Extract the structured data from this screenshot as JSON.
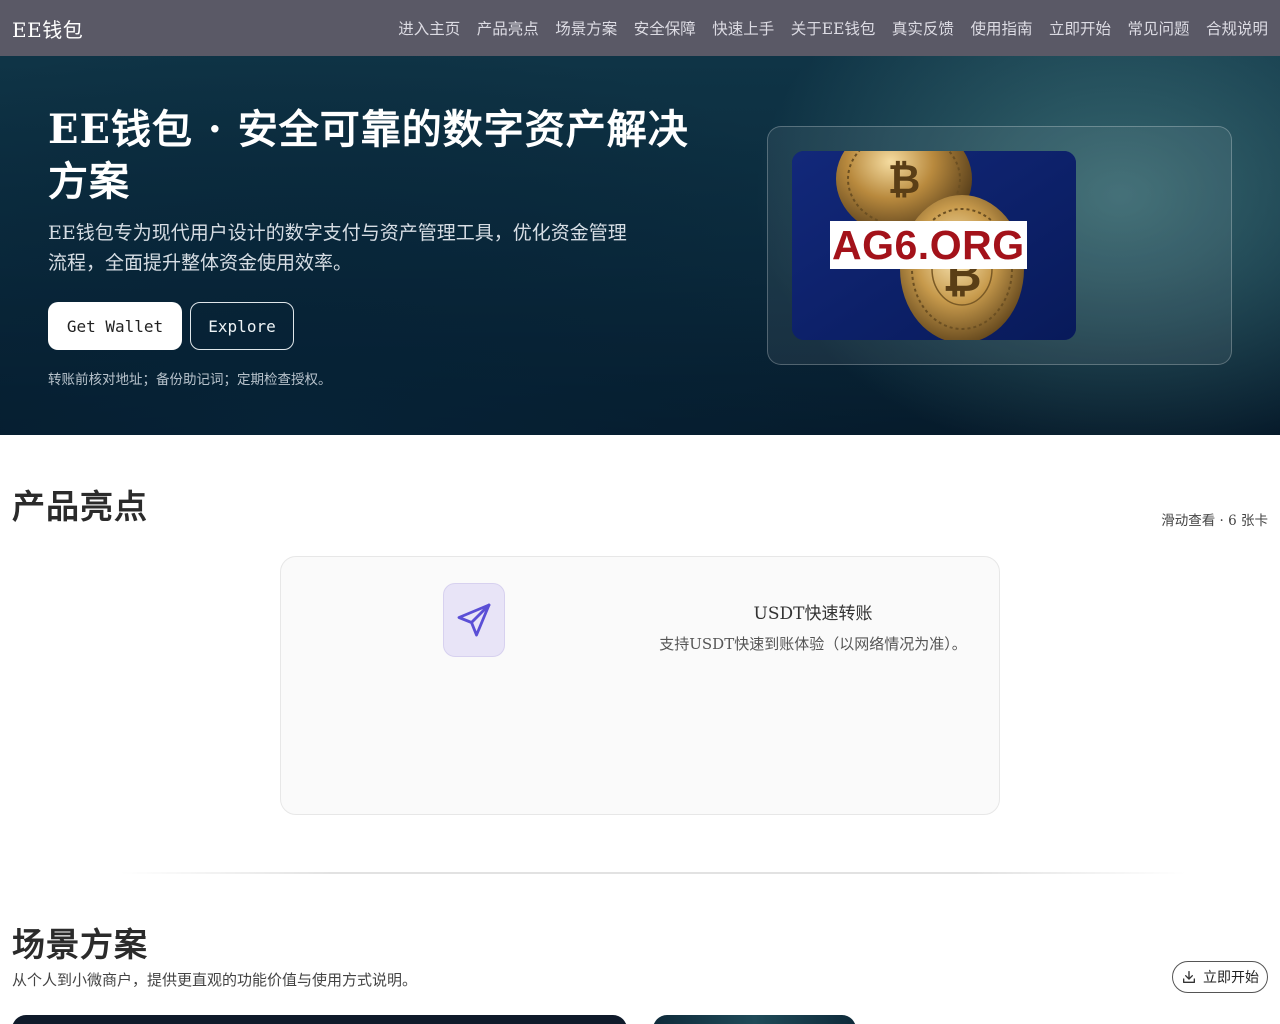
{
  "nav": {
    "brand": "EE钱包",
    "links": [
      "进入主页",
      "产品亮点",
      "场景方案",
      "安全保障",
      "快速上手",
      "关于EE钱包",
      "真实反馈",
      "使用指南",
      "立即开始",
      "常见问题",
      "合规说明"
    ]
  },
  "hero": {
    "title": "EE钱包 · 安全可靠的数字资产解决方案",
    "subtitle": "EE钱包专为现代用户设计的数字支付与资产管理工具，优化资金管理流程，全面提升整体资金使用效率。",
    "primary_button": "Get Wallet",
    "secondary_button": "Explore",
    "tip": "转账前核对地址；备份助记词；定期检查授权。",
    "image_label": "AG6.ORG"
  },
  "features": {
    "title": "产品亮点",
    "meta": "滑动查看 · 6 张卡",
    "card": {
      "icon": "send-icon",
      "name": "USDT快速转账",
      "description": "支持USDT快速到账体验（以网络情况为准）。"
    }
  },
  "scenarios": {
    "title": "场景方案",
    "subtitle": "从个人到小微商户，提供更直观的功能价值与使用方式说明。",
    "start_button": "立即开始",
    "start_icon": "download-icon"
  },
  "colors": {
    "nav_bg": "#5a5966",
    "hero_bg": "#0b2a3c",
    "icon_accent": "#5b4fd6",
    "label_red": "#a3121a"
  }
}
